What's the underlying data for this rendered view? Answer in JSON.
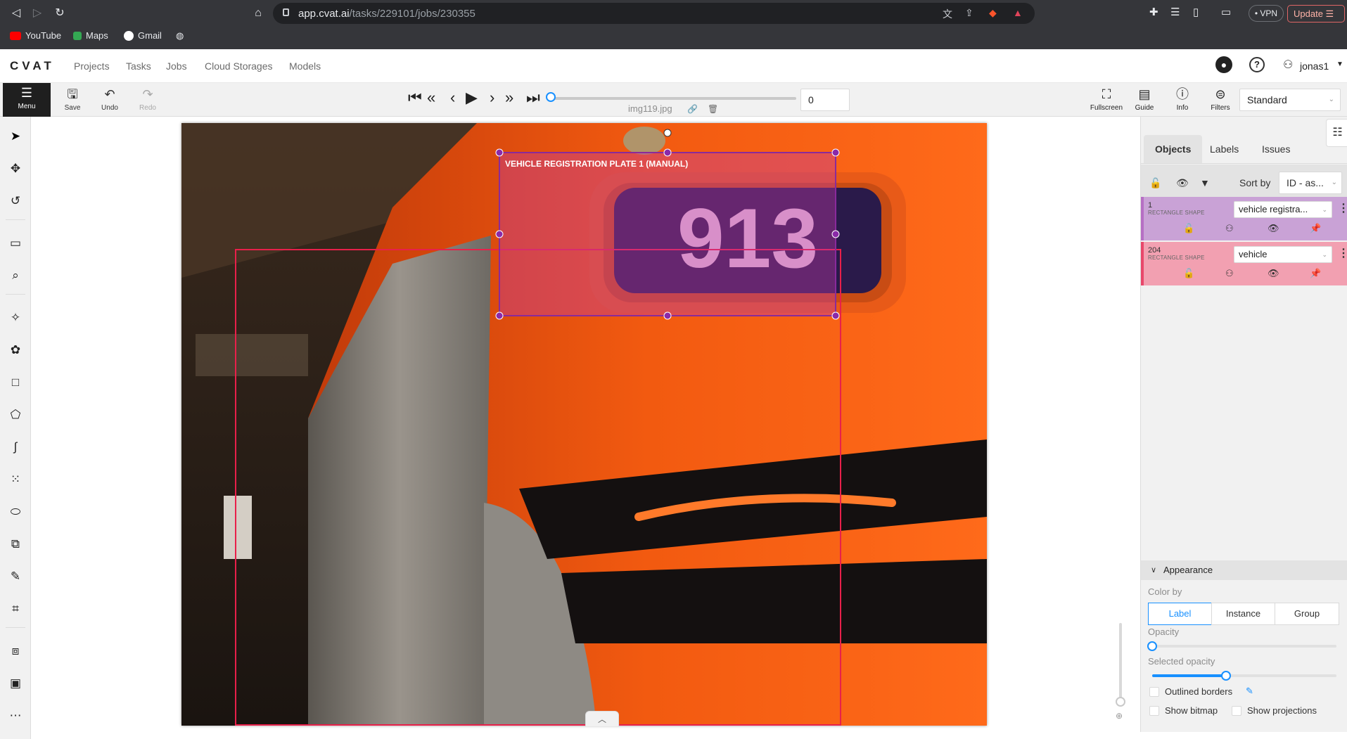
{
  "browser": {
    "url_host": "app.cvat.ai",
    "url_path": "/tasks/229101/jobs/230355",
    "vpn_label": "VPN",
    "update_label": "Update",
    "bookmarks": [
      "YouTube",
      "Maps",
      "Gmail"
    ]
  },
  "header": {
    "logo": "CVAT",
    "nav": [
      "Projects",
      "Tasks",
      "Jobs",
      "Cloud Storages",
      "Models"
    ],
    "username": "jonas1"
  },
  "toolbar": {
    "menu_label": "Menu",
    "save_label": "Save",
    "undo_label": "Undo",
    "redo_label": "Redo",
    "frame_number": "0",
    "frame_name": "img119.jpg",
    "fullscreen_label": "Fullscreen",
    "guide_label": "Guide",
    "info_label": "Info",
    "filters_label": "Filters",
    "workspace": "Standard"
  },
  "canvas": {
    "plate_text": "913",
    "selected_shape_caption": "VEHICLE REGISTRATION PLATE 1 (MANUAL)",
    "colors": {
      "plate_shape": "#c03aa8",
      "vehicle_shape": "#e8204a"
    }
  },
  "sidebar": {
    "tabs": [
      "Objects",
      "Labels",
      "Issues"
    ],
    "active_tab": "Objects",
    "sort_label": "Sort by",
    "sort_value": "ID - as...",
    "objects": [
      {
        "id": "1",
        "type": "RECTANGLE SHAPE",
        "label": "vehicle registra...",
        "color": "#b66fc4",
        "bg": "#c9a2d6"
      },
      {
        "id": "204",
        "type": "RECTANGLE SHAPE",
        "label": "vehicle",
        "color": "#e8476b",
        "bg": "#f2a0b1"
      }
    ],
    "appearance": {
      "title": "Appearance",
      "color_by_label": "Color by",
      "color_by_options": [
        "Label",
        "Instance",
        "Group"
      ],
      "color_by_selected": "Label",
      "opacity_label": "Opacity",
      "opacity": 0,
      "selected_opacity_label": "Selected opacity",
      "selected_opacity": 0.4,
      "outlined_borders_label": "Outlined borders",
      "show_bitmap_label": "Show bitmap",
      "show_projections_label": "Show projections"
    }
  }
}
